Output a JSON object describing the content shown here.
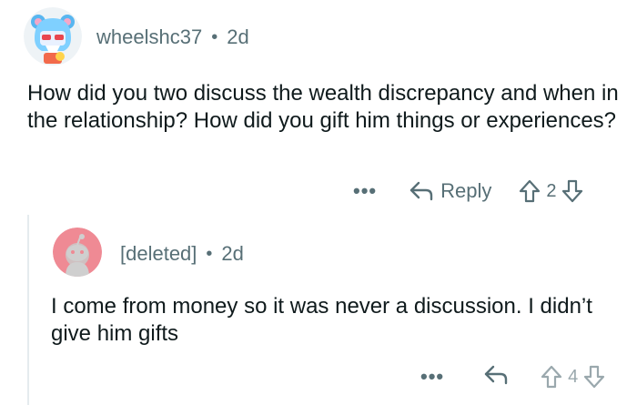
{
  "comments": [
    {
      "username": "wheelshc37",
      "age": "2d",
      "body": "How did you two discuss the wealth discrepancy and when in the relationship? How did you gift him things or experiences?",
      "reply_label": "Reply",
      "votes": "2",
      "more_label": "•••",
      "avatar_icon": "anime-avatar-icon"
    },
    {
      "username": "[deleted]",
      "age": "2d",
      "body": "I come from money so it was never a discussion. I didn’t give him gifts",
      "votes": "4",
      "more_label": "•••",
      "avatar_icon": "reddit-snoo-icon"
    }
  ],
  "colors": {
    "meta": "#576f76",
    "text": "#0f1a1c",
    "deleted_avatar": "#ef8a94",
    "thread_line": "#e5ebee"
  }
}
